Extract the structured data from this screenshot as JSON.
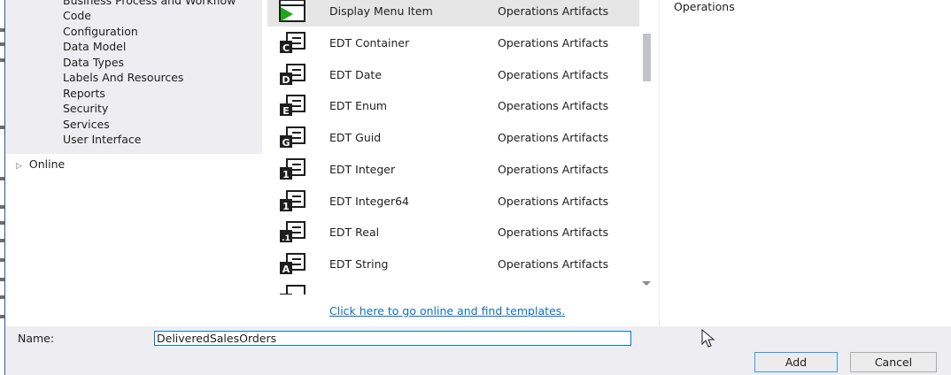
{
  "tree": {
    "items": [
      "Business Process and Workflow",
      "Code",
      "Configuration",
      "Data Model",
      "Data Types",
      "Labels And Resources",
      "Reports",
      "Security",
      "Services",
      "User Interface"
    ],
    "online": "Online"
  },
  "list": {
    "items": [
      {
        "name": "Display Menu Item",
        "category": "Operations Artifacts",
        "glyph": ""
      },
      {
        "name": "EDT Container",
        "category": "Operations Artifacts",
        "glyph": "C"
      },
      {
        "name": "EDT Date",
        "category": "Operations Artifacts",
        "glyph": "D"
      },
      {
        "name": "EDT Enum",
        "category": "Operations Artifacts",
        "glyph": "E"
      },
      {
        "name": "EDT Guid",
        "category": "Operations Artifacts",
        "glyph": "G"
      },
      {
        "name": "EDT Integer",
        "category": "Operations Artifacts",
        "glyph": "1"
      },
      {
        "name": "EDT Integer64",
        "category": "Operations Artifacts",
        "glyph": "1"
      },
      {
        "name": "EDT Real",
        "category": "Operations Artifacts",
        "glyph": ".1"
      },
      {
        "name": "EDT String",
        "category": "Operations Artifacts",
        "glyph": "A"
      }
    ],
    "online_link": "Click here to go online and find templates."
  },
  "detail": {
    "description": "Operations"
  },
  "form": {
    "name_label": "Name:",
    "name_value": "DeliveredSalesOrders",
    "add_label": "Add",
    "cancel_label": "Cancel"
  },
  "colors": {
    "accent": "#007acc",
    "link": "#0e70c0",
    "play_green": "#1ba81b",
    "panel_bg": "#eeeef2"
  }
}
